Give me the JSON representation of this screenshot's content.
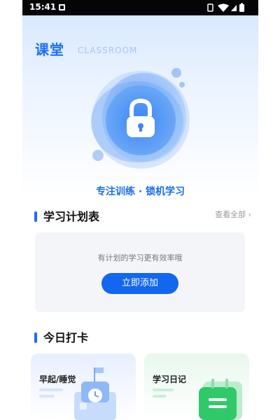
{
  "status": {
    "time": "15:41"
  },
  "header": {
    "title": "课堂",
    "subtitle": "CLASSROOM"
  },
  "hero": {
    "motto": "专注训练 · 锁机学习"
  },
  "plan": {
    "title": "学习计划表",
    "see_all": "查看全部 ›",
    "hint": "有计划的学习更有效率哦",
    "button": "立即添加"
  },
  "checkin": {
    "title": "今日打卡",
    "card1": "早起/睡觉",
    "card2": "学习日记"
  },
  "icons": {
    "status_left": "notification-icon",
    "lock": "lock-icon",
    "card1": "school-clock-icon",
    "card2": "diary-book-icon"
  },
  "colors": {
    "brand": "#1f6ff5",
    "button": "#1366ee",
    "accent": "#1e6df3"
  }
}
